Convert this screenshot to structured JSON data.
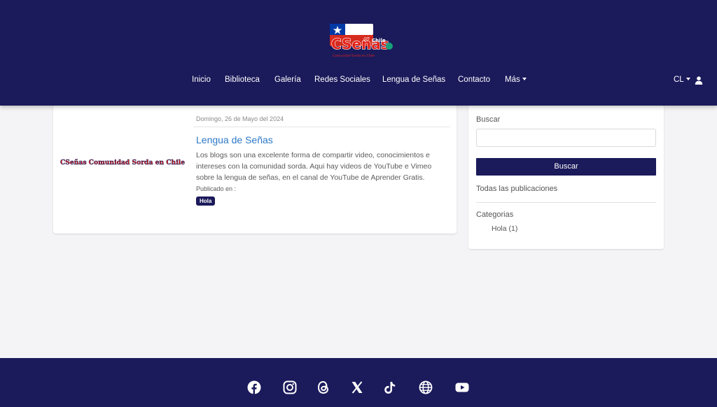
{
  "header": {
    "logo": {
      "text": "CSeñas",
      "sup": "Chile",
      "tagline": "Comunidad Sorda en Chile"
    },
    "nav": [
      {
        "label": "Inicio"
      },
      {
        "label": "Biblioteca"
      },
      {
        "label": "Galería"
      },
      {
        "label": "Redes Sociales"
      },
      {
        "label": "Lengua de Señas"
      },
      {
        "label": "Contacto"
      },
      {
        "label": "Más"
      }
    ],
    "lang": "CL",
    "user_icon": "user-icon"
  },
  "post": {
    "thumbnail_text": "CSeñas Comunidad Sorda en Chile",
    "date": "Domingo, 26 de Mayo del 2024",
    "title": "Lengua de Señas",
    "body": "Los blogs son una excelente forma de compartir video, conocimientos e intereses con la comunidad sorda. Aqui hay videos de YouTube e Vimeo sobre la lengua de señas, en el canal de YouTube de Aprender Gratis.",
    "published_label": "Publicado en :",
    "tag": "Hola"
  },
  "sidebar": {
    "search_label": "Buscar",
    "search_value": "",
    "search_button": "Buscar",
    "all_posts": "Todas las publicaciones",
    "categories_title": "Categorias",
    "categories": [
      {
        "label": "Hola (1)"
      }
    ]
  },
  "footer": {
    "social_icons": [
      "facebook-icon",
      "instagram-icon",
      "threads-icon",
      "x-icon",
      "tiktok-icon",
      "globe-icon",
      "youtube-icon"
    ]
  },
  "colors": {
    "primary": "#1b1a5b",
    "link": "#2d79c7",
    "background": "#f4f3f5"
  }
}
